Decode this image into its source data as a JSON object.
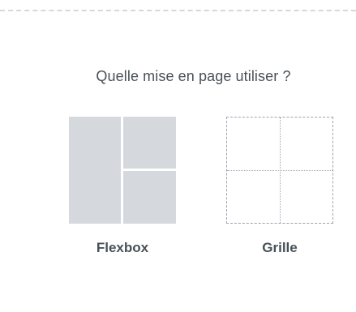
{
  "layout_picker": {
    "prompt": "Quelle mise en page utiliser ?",
    "options": [
      {
        "label": "Flexbox"
      },
      {
        "label": "Grille"
      }
    ]
  },
  "colors": {
    "text": "#495157",
    "preview_fill": "#d5d8dc",
    "dashed_border": "#9da5ae"
  }
}
